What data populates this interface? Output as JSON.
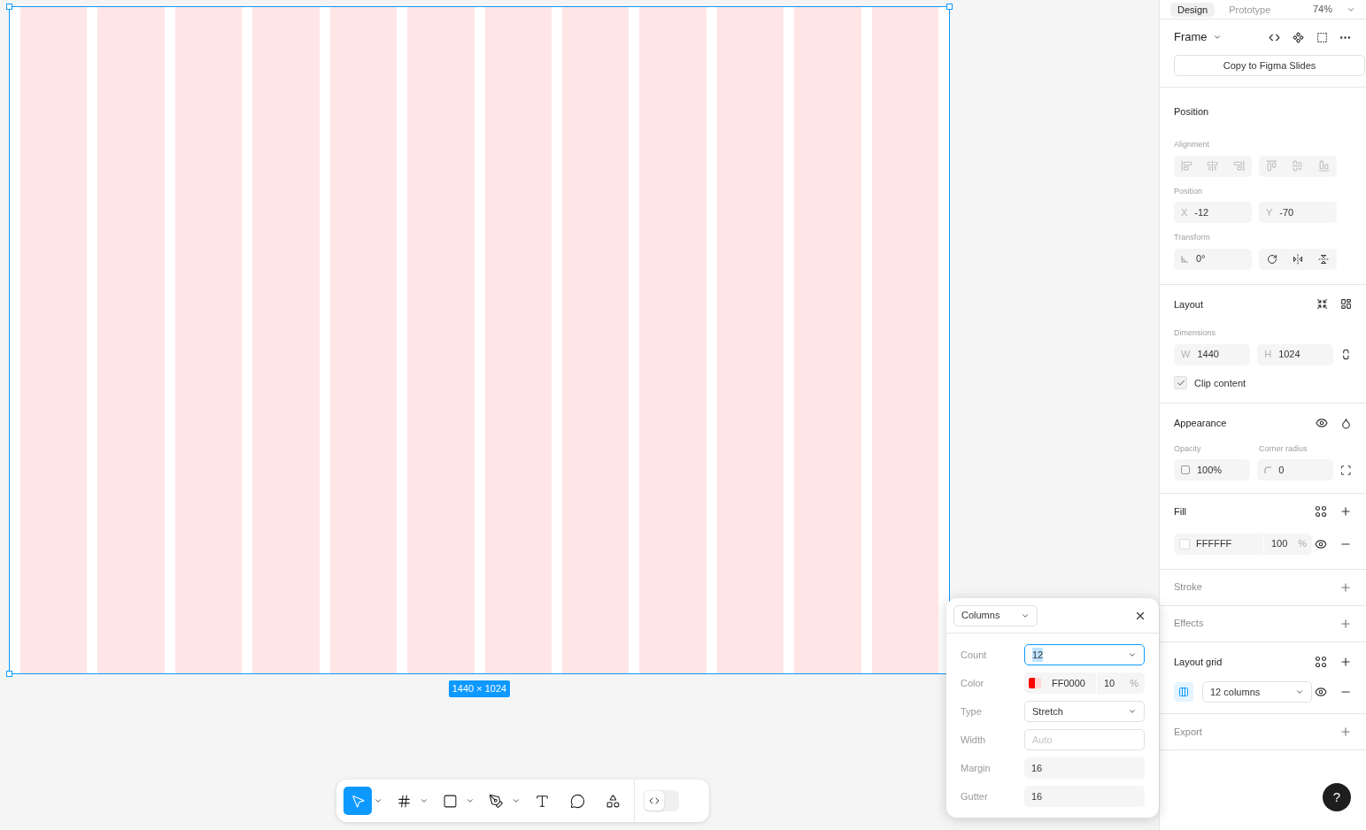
{
  "canvas": {
    "size_label": "1440 × 1024"
  },
  "toolbar": {
    "tools": [
      {
        "kind": "move",
        "selected": true,
        "dropdown": true
      },
      {
        "kind": "frame",
        "selected": false,
        "dropdown": true
      },
      {
        "kind": "rectangle",
        "selected": false,
        "dropdown": true
      },
      {
        "kind": "pen",
        "selected": false,
        "dropdown": true
      },
      {
        "kind": "text",
        "selected": false,
        "dropdown": false
      },
      {
        "kind": "comment",
        "selected": false,
        "dropdown": false
      },
      {
        "kind": "actions",
        "selected": false,
        "dropdown": false
      }
    ],
    "dev_mode": {
      "on": false
    }
  },
  "panel": {
    "tabs": [
      {
        "label": "Design",
        "selected": true
      },
      {
        "label": "Prototype",
        "selected": false
      }
    ],
    "zoom": "74%",
    "frame": {
      "title": "Frame",
      "button": "Copy to Figma Slides"
    },
    "position": {
      "title": "Position",
      "alignment_label": "Alignment",
      "position_label": "Position",
      "x": {
        "prefix": "X",
        "value": "-12"
      },
      "y": {
        "prefix": "Y",
        "value": "-70"
      },
      "transform_label": "Transform",
      "rotation": "0°"
    },
    "layout": {
      "title": "Layout",
      "dimensions_label": "Dimensions",
      "w": {
        "prefix": "W",
        "value": "1440"
      },
      "h": {
        "prefix": "H",
        "value": "1024"
      },
      "clip": {
        "label": "Clip content",
        "checked": true
      }
    },
    "appearance": {
      "title": "Appearance",
      "opacity_label": "Opacity",
      "opacity": "100%",
      "corner_label": "Corner radius",
      "corner": "0"
    },
    "fill": {
      "title": "Fill",
      "hex": "FFFFFF",
      "color": "#ffffff",
      "opacity": "100",
      "unit": "%"
    },
    "stroke": {
      "title": "Stroke"
    },
    "effects": {
      "title": "Effects"
    },
    "layout_grid": {
      "title": "Layout grid",
      "value": "12 columns"
    },
    "export": {
      "title": "Export"
    },
    "help": "?"
  },
  "grid_popup": {
    "type": "Columns",
    "rows": [
      {
        "kind": "select",
        "label": "Count",
        "value": "12",
        "focused": true
      },
      {
        "kind": "color",
        "label": "Color",
        "hex": "FF0000",
        "color": "#ff0000",
        "opacity": "10",
        "unit": "%"
      },
      {
        "kind": "select",
        "label": "Type",
        "value": "Stretch",
        "focused": false
      },
      {
        "kind": "input",
        "label": "Width",
        "placeholder": "Auto"
      },
      {
        "kind": "static",
        "label": "Margin",
        "value": "16"
      },
      {
        "kind": "static",
        "label": "Gutter",
        "value": "16"
      }
    ]
  }
}
